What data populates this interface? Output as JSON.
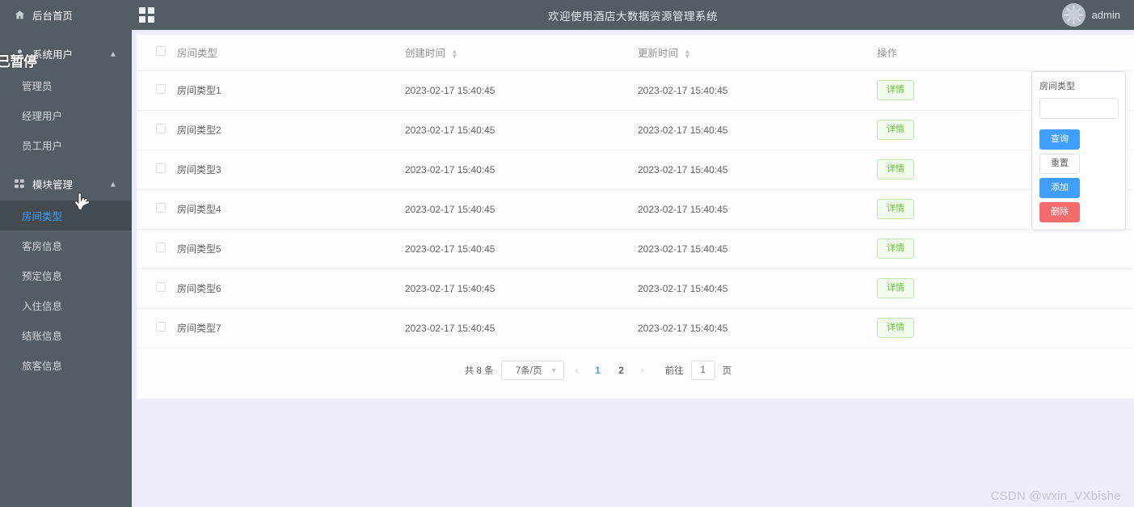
{
  "colors": {
    "sidebar_bg": "#545c64",
    "sidebar_active_bg": "#434a50",
    "accent_blue": "#409eff",
    "danger_red": "#f56c6c",
    "success_green": "#67c23a",
    "content_bg": "#ececfc",
    "card_bg": "#fdfdff"
  },
  "sidebar": {
    "home": {
      "label": "后台首页",
      "icon": "home-icon"
    },
    "groups": [
      {
        "label": "系统用户",
        "icon": "user-icon",
        "arrow": "chevron-up-icon",
        "items": [
          {
            "label": "管理员",
            "active": false
          },
          {
            "label": "经理用户",
            "active": false
          },
          {
            "label": "员工用户",
            "active": false
          }
        ]
      },
      {
        "label": "模块管理",
        "icon": "grid-small-icon",
        "arrow": "chevron-up-icon",
        "items": [
          {
            "label": "房间类型",
            "active": true
          },
          {
            "label": "客房信息",
            "active": false
          },
          {
            "label": "预定信息",
            "active": false
          },
          {
            "label": "入住信息",
            "active": false
          },
          {
            "label": "结账信息",
            "active": false
          },
          {
            "label": "旅客信息",
            "active": false
          }
        ]
      }
    ]
  },
  "overlay": {
    "paused_text": "已暂停"
  },
  "topbar": {
    "menu_toggle_icon": "grid-icon",
    "title": "欢迎使用酒店大数据资源管理系统",
    "avatar_icon": "spinner-avatar",
    "username": "admin"
  },
  "table": {
    "columns": [
      {
        "key": "checkbox",
        "label": "",
        "sortable": false
      },
      {
        "key": "type",
        "label": "房间类型",
        "sortable": false
      },
      {
        "key": "ctime",
        "label": "创建时间",
        "sortable": true
      },
      {
        "key": "utime",
        "label": "更新时间",
        "sortable": true
      },
      {
        "key": "action",
        "label": "操作",
        "sortable": false
      }
    ],
    "action_label": "详情",
    "rows": [
      {
        "type": "房间类型1",
        "ctime": "2023-02-17 15:40:45",
        "utime": "2023-02-17 15:40:45"
      },
      {
        "type": "房间类型2",
        "ctime": "2023-02-17 15:40:45",
        "utime": "2023-02-17 15:40:45"
      },
      {
        "type": "房间类型3",
        "ctime": "2023-02-17 15:40:45",
        "utime": "2023-02-17 15:40:45"
      },
      {
        "type": "房间类型4",
        "ctime": "2023-02-17 15:40:45",
        "utime": "2023-02-17 15:40:45"
      },
      {
        "type": "房间类型5",
        "ctime": "2023-02-17 15:40:45",
        "utime": "2023-02-17 15:40:45"
      },
      {
        "type": "房间类型6",
        "ctime": "2023-02-17 15:40:45",
        "utime": "2023-02-17 15:40:45"
      },
      {
        "type": "房间类型7",
        "ctime": "2023-02-17 15:40:45",
        "utime": "2023-02-17 15:40:45"
      }
    ]
  },
  "pagination": {
    "total_text": "共 8 条",
    "page_size_value": "7条/页",
    "prev_icon": "chevron-left-icon",
    "next_icon": "chevron-right-icon",
    "pages": [
      {
        "label": "1",
        "active": true
      },
      {
        "label": "2",
        "active": false
      }
    ],
    "jump_label": "前往",
    "jump_value": "1",
    "jump_suffix": "页"
  },
  "search_panel": {
    "field_label": "房间类型",
    "field_value": "",
    "field_placeholder": "",
    "buttons": [
      {
        "label": "查询",
        "style": "primary"
      },
      {
        "label": "重置",
        "style": "plain"
      },
      {
        "label": "添加",
        "style": "primary"
      },
      {
        "label": "删除",
        "style": "danger"
      }
    ]
  },
  "watermark": {
    "text": "CSDN @wxin_VXbishe"
  }
}
